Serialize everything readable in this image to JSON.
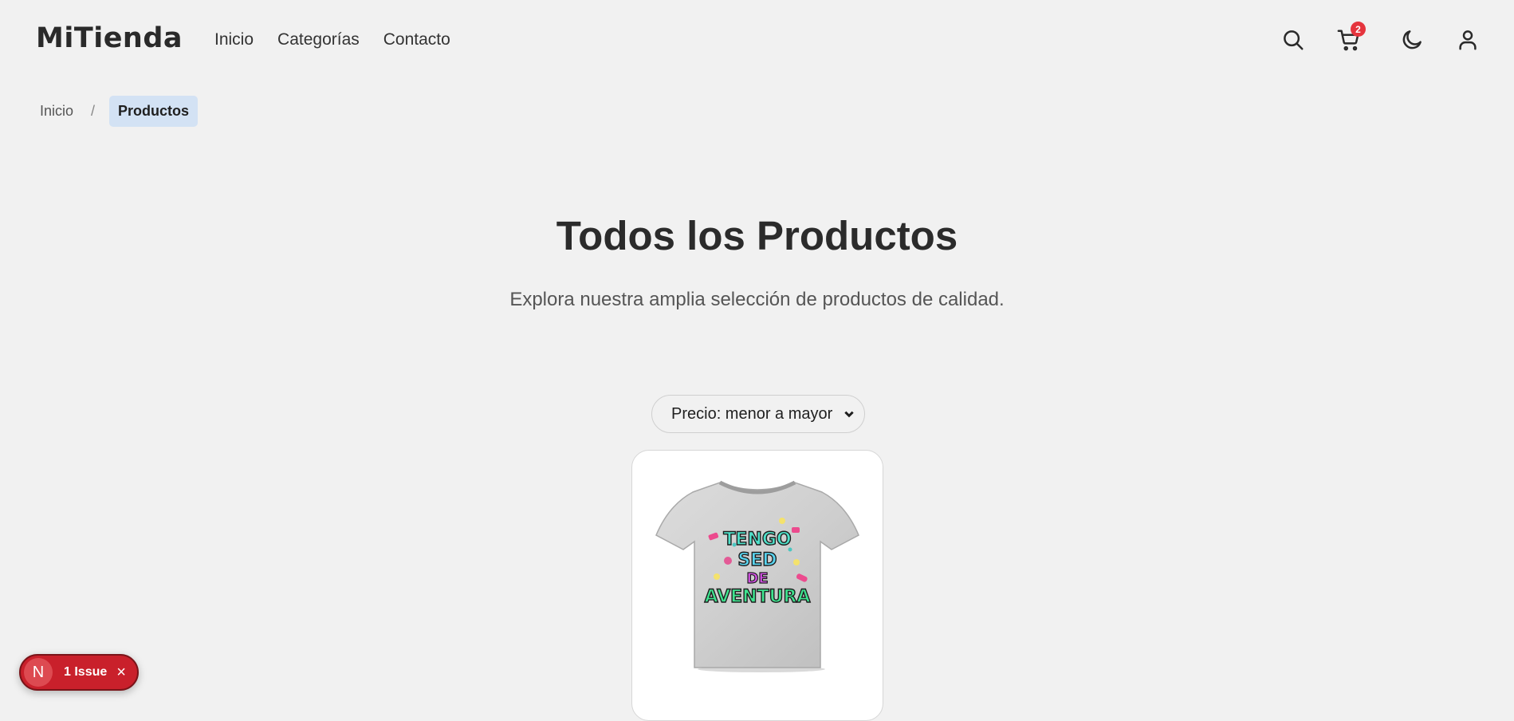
{
  "header": {
    "brand": "MiTienda",
    "nav": [
      "Inicio",
      "Categorías",
      "Contacto"
    ],
    "cart_count": "2",
    "icons": [
      "search-icon",
      "cart-icon",
      "moon-icon",
      "user-icon"
    ]
  },
  "breadcrumb": {
    "home": "Inicio",
    "separator": "/",
    "current": "Productos"
  },
  "hero": {
    "title": "Todos los Productos",
    "subtitle": "Explora nuestra amplia selección de productos de calidad."
  },
  "sort": {
    "selected": "Precio: menor a mayor"
  },
  "products": [
    {
      "image_alt": "Camiseta gris con estampado",
      "print_lines": [
        "TENGO",
        "SED",
        "DE",
        "AVENTURA"
      ]
    }
  ],
  "issue": {
    "badge": "N",
    "label": "1 Issue",
    "close": "×"
  },
  "colors": {
    "background": "#f1f1f1",
    "badge_red": "#e5343d",
    "breadcrumb_active": "#d3e2f4",
    "issue_red": "#c9202b"
  }
}
